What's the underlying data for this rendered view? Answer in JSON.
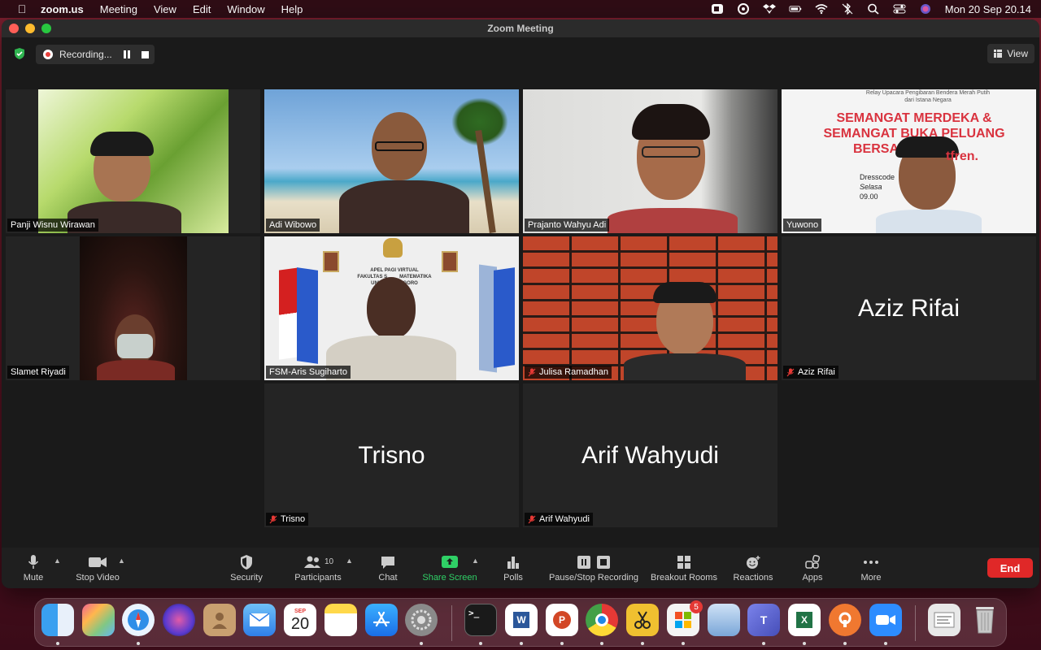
{
  "menubar": {
    "app_name": "zoom.us",
    "menus": [
      "Meeting",
      "View",
      "Edit",
      "Window",
      "Help"
    ],
    "clock": "Mon 20 Sep  20.14"
  },
  "window": {
    "title": "Zoom Meeting"
  },
  "topbar": {
    "recording_label": "Recording...",
    "view_label": "View"
  },
  "participants": [
    {
      "name": "Panji Wisnu Wirawan",
      "video": true,
      "muted": false
    },
    {
      "name": "Adi Wibowo",
      "video": true,
      "muted": false,
      "active_speaker": true
    },
    {
      "name": "Prajanto Wahyu Adi",
      "video": true,
      "muted": false
    },
    {
      "name": "Yuwono",
      "video": true,
      "muted": false
    },
    {
      "name": "Slamet Riyadi",
      "video": true,
      "muted": false
    },
    {
      "name": "FSM-Aris Sugiharto",
      "video": true,
      "muted": false
    },
    {
      "name": "Julisa Ramadhan",
      "video": true,
      "muted": true
    },
    {
      "name": "Aziz Rifai",
      "video": false,
      "muted": true
    },
    {
      "name": "Trisno",
      "video": false,
      "muted": true
    },
    {
      "name": "Arif Wahyudi",
      "video": false,
      "muted": true
    }
  ],
  "backgrounds": {
    "yuwono_banner_line1": "Relay Upacara Pengibaran Bendera Merah Putih",
    "yuwono_banner_line2": "dari Istana Negara",
    "yuwono_headline1": "SEMANGAT MERDEKA &",
    "yuwono_headline2": "SEMANGAT BUKA PELUANG",
    "yuwono_headline3": "BERSAM",
    "yuwono_brand": "tfren.",
    "yuwono_detail1": "Dresscode",
    "yuwono_detail2": "Selasa",
    "yuwono_detail3": "09.00",
    "aris_line1": "APEL PAGI VIRTUAL",
    "aris_line2": "FAKULTAS S",
    "aris_line2b": "MATEMATIKA",
    "aris_line3": "UNIV",
    "aris_line3b": "GORO"
  },
  "toolbar": {
    "mute": "Mute",
    "stop_video": "Stop Video",
    "security": "Security",
    "participants": "Participants",
    "participants_count": "10",
    "chat": "Chat",
    "share_screen": "Share Screen",
    "polls": "Polls",
    "recording": "Pause/Stop Recording",
    "breakout": "Breakout Rooms",
    "reactions": "Reactions",
    "apps": "Apps",
    "more": "More",
    "end": "End"
  },
  "dock": {
    "calendar_month": "SEP",
    "calendar_day": "20",
    "appstore_badge": "5"
  },
  "colors": {
    "active_speaker_border": "#d6e06a",
    "end_button": "#e02828",
    "share_green": "#2fd066"
  }
}
